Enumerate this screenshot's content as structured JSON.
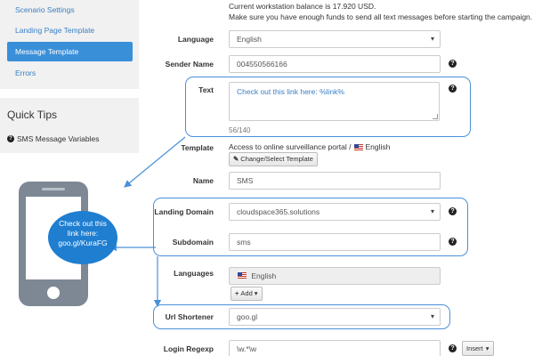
{
  "sidebar": {
    "items": [
      {
        "label": "Scenario Settings"
      },
      {
        "label": "Landing Page Template"
      },
      {
        "label": "Message Template"
      },
      {
        "label": "Errors"
      }
    ]
  },
  "quick_tips": {
    "title": "Quick Tips",
    "item": "SMS Message Variables"
  },
  "info": {
    "balance": "Current workstation balance is 17.920 USD.",
    "notice": "Make sure you have enough funds to send all text messages before starting the campaign."
  },
  "form": {
    "language": {
      "label": "Language",
      "value": "English"
    },
    "sender_name": {
      "label": "Sender Name",
      "value": "004550566166"
    },
    "text": {
      "label": "Text",
      "value": "Check out this link here: %link%",
      "counter": "56/140"
    },
    "template": {
      "label": "Template",
      "value": "Access to online surveillance portal / ",
      "lang": "English",
      "button": "Change/Select Template"
    },
    "name": {
      "label": "Name",
      "value": "SMS"
    },
    "landing_domain": {
      "label": "Landing Domain",
      "value": "cloudspace365.solutions"
    },
    "subdomain": {
      "label": "Subdomain",
      "value": "sms"
    },
    "languages": {
      "label": "Languages",
      "value": "English",
      "add_button": "Add"
    },
    "url_shortener": {
      "label": "Url Shortener",
      "value": "goo.gl"
    },
    "login_regexp": {
      "label": "Login Regexp",
      "value": "\\w.*\\w",
      "insert_button": "Insert"
    }
  },
  "phone_bubble": {
    "line1": "Check out this",
    "line2": "link here:",
    "line3": "goo.gl/KuraFG"
  },
  "colors": {
    "accent": "#3a8fd9",
    "highlight": "#4a90d9",
    "bubble": "#1f7ed0",
    "phone": "#7d8894"
  }
}
